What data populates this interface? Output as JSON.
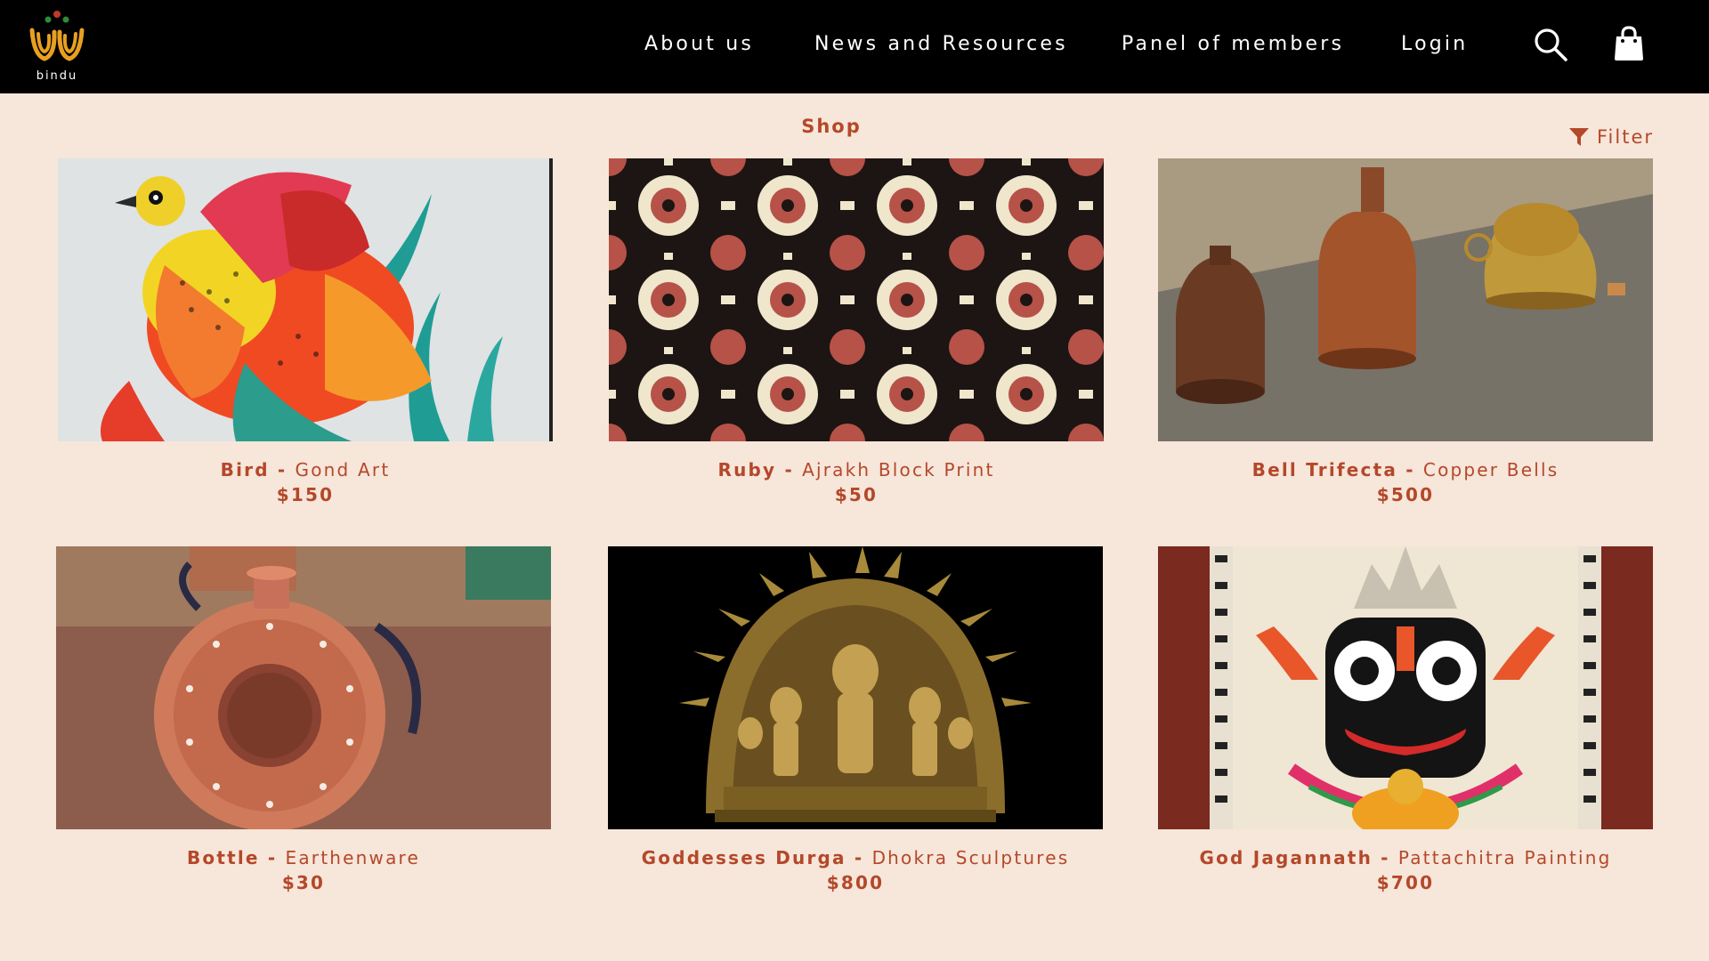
{
  "brand": {
    "name": "bindu"
  },
  "nav": {
    "items": [
      {
        "label": "About us"
      },
      {
        "label": "News and Resources"
      },
      {
        "label": "Panel of members"
      },
      {
        "label": "Login"
      }
    ],
    "icons": [
      "search-icon",
      "shopping-bag-icon"
    ]
  },
  "shop": {
    "title": "Shop",
    "filter_label": "Filter",
    "filter_icon": "funnel-icon"
  },
  "colors": {
    "header_bg": "#000000",
    "page_bg": "#f7e6da",
    "accent": "#b4482a"
  },
  "products": [
    {
      "name": "Bird - ",
      "type": "Gond Art",
      "price": "$150"
    },
    {
      "name": "Ruby - ",
      "type": "Ajrakh Block Print",
      "price": "$50"
    },
    {
      "name": "Bell Trifecta - ",
      "type": "Copper Bells",
      "price": "$500"
    },
    {
      "name": "Bottle - ",
      "type": "Earthenware",
      "price": "$30"
    },
    {
      "name": "Goddesses Durga - ",
      "type": "Dhokra Sculptures",
      "price": "$800"
    },
    {
      "name": "God Jagannath - ",
      "type": "Pattachitra Painting",
      "price": "$700"
    }
  ]
}
